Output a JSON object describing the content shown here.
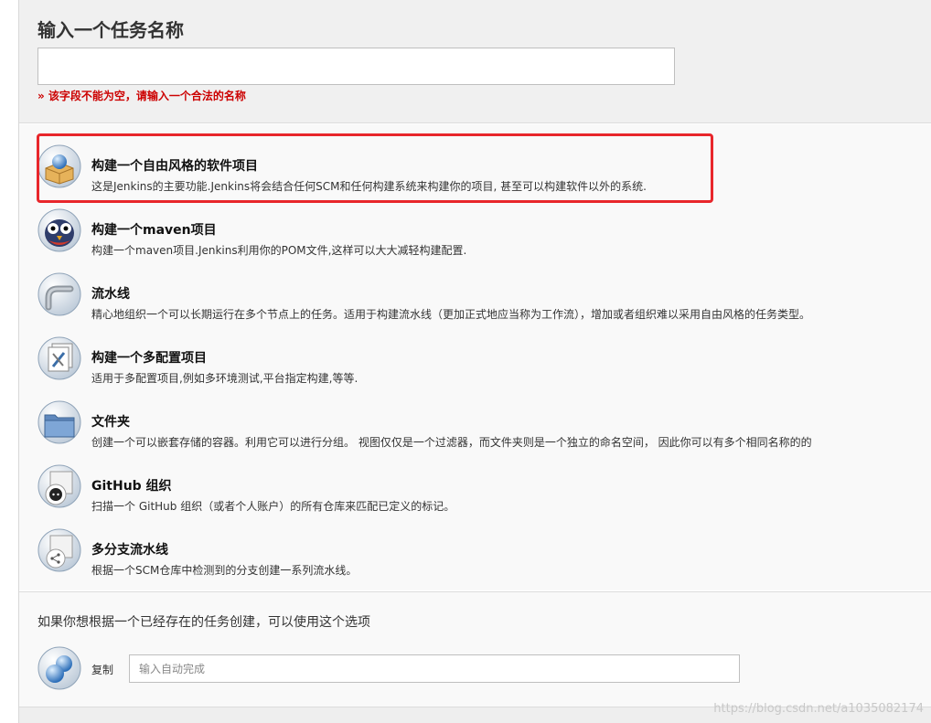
{
  "header": {
    "title": "输入一个任务名称",
    "error": "» 该字段不能为空，请输入一个合法的名称"
  },
  "items": [
    {
      "title": "构建一个自由风格的软件项目",
      "desc": "这是Jenkins的主要功能.Jenkins将会结合任何SCM和任何构建系统来构建你的项目, 甚至可以构建软件以外的系统.",
      "icon": "freestyle-box-icon"
    },
    {
      "title": "构建一个maven项目",
      "desc": "构建一个maven项目.Jenkins利用你的POM文件,这样可以大大减轻构建配置.",
      "icon": "maven-owl-icon"
    },
    {
      "title": "流水线",
      "desc": "精心地组织一个可以长期运行在多个节点上的任务。适用于构建流水线（更加正式地应当称为工作流），增加或者组织难以采用自由风格的任务类型。",
      "icon": "pipeline-icon"
    },
    {
      "title": "构建一个多配置项目",
      "desc": "适用于多配置项目,例如多环境测试,平台指定构建,等等.",
      "icon": "multiconfig-icon"
    },
    {
      "title": "文件夹",
      "desc": "创建一个可以嵌套存储的容器。利用它可以进行分组。 视图仅仅是一个过滤器，而文件夹则是一个独立的命名空间， 因此你可以有多个相同名称的的",
      "icon": "folder-icon"
    },
    {
      "title": "GitHub 组织",
      "desc": "扫描一个 GitHub 组织（或者个人账户）的所有仓库来匹配已定义的标记。",
      "icon": "github-icon"
    },
    {
      "title": "多分支流水线",
      "desc": "根据一个SCM仓库中检测到的分支创建一系列流水线。",
      "icon": "multibranch-icon"
    }
  ],
  "copy": {
    "hint": "如果你想根据一个已经存在的任务创建，可以使用这个选项",
    "label": "复制",
    "placeholder": "输入自动完成"
  },
  "watermark": "https://blog.csdn.net/a1035082174"
}
